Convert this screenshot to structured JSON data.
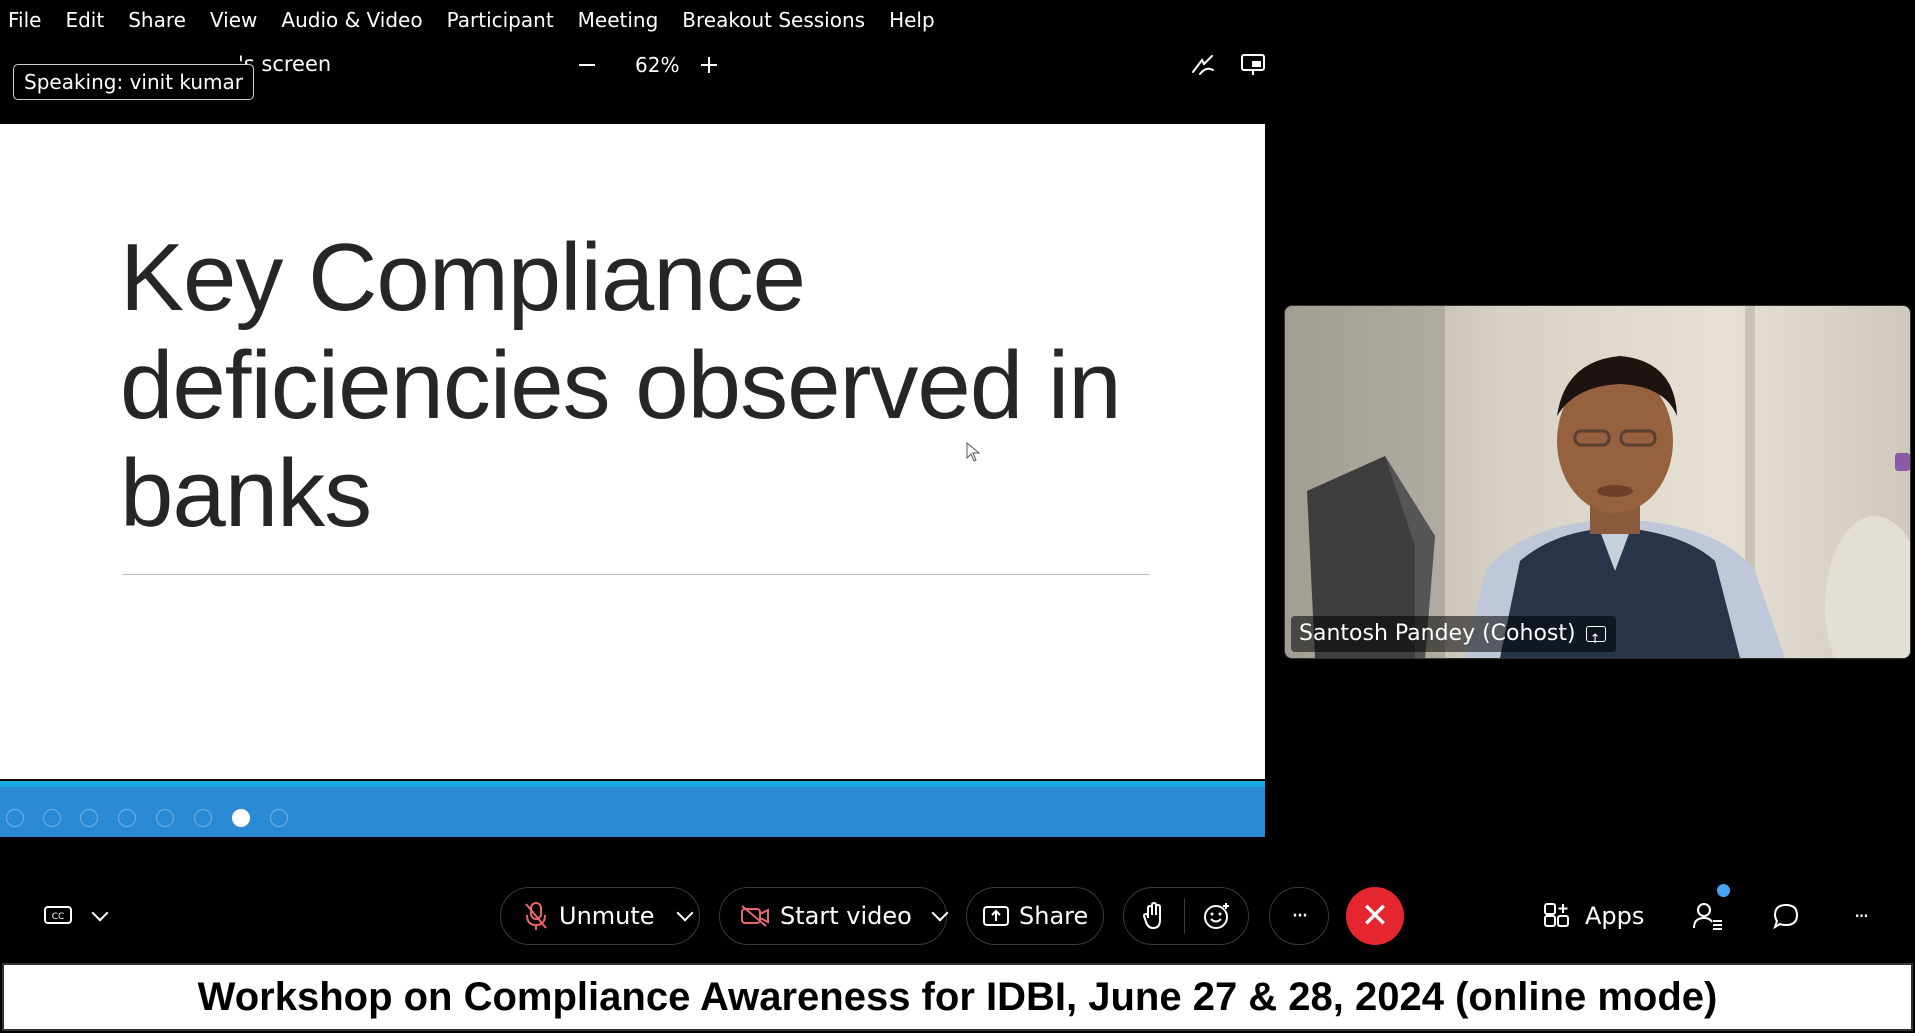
{
  "menu": [
    "File",
    "Edit",
    "Share",
    "View",
    "Audio & Video",
    "Participant",
    "Meeting",
    "Breakout Sessions",
    "Help"
  ],
  "share_header": {
    "title_suffix": "'s screen",
    "speaking_label": "Speaking:",
    "speaking_name": "vinit kumar",
    "zoom": "62%"
  },
  "slide": {
    "title": "Key Compliance deficiencies observed in banks"
  },
  "video": {
    "participant_name": "Santosh Pandey (Cohost)"
  },
  "toolbar": {
    "unmute_label": "Unmute",
    "start_video_label": "Start video",
    "share_label": "Share",
    "more_label": "···",
    "apps_label": "Apps",
    "overflow_label": "···",
    "end_label": "✕"
  },
  "colors": {
    "end_call": "#e5262f",
    "muted_icon": "#e8666d",
    "slide_bar": "#2a8ad4",
    "notification_dot": "#4aa3f0"
  },
  "banner": {
    "text": "Workshop on Compliance Awareness for IDBI, June 27 & 28, 2024 (online mode)"
  }
}
